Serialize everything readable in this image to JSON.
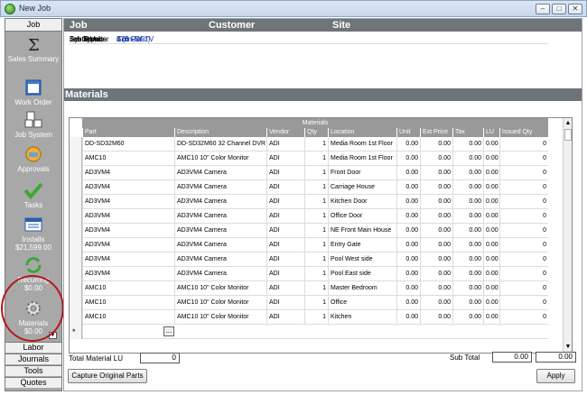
{
  "window": {
    "title": "New Job"
  },
  "sidebar": {
    "header": "Job",
    "items": [
      {
        "label": "Sales Summary",
        "icon": "sigma-icon"
      },
      {
        "label": "Work Order",
        "icon": "work-order-icon"
      },
      {
        "label": "Job System",
        "icon": "job-system-icon"
      },
      {
        "label": "Approvals",
        "icon": "approvals-icon"
      },
      {
        "label": "Tasks",
        "icon": "checkmark-icon"
      },
      {
        "label": "Installs",
        "sub": "$21,599.00",
        "icon": "installs-icon"
      },
      {
        "label": "Recurring",
        "sub": "$0.00",
        "icon": "recurring-icon"
      },
      {
        "label": "Materials",
        "sub": "$0.00",
        "icon": "gear-icon"
      }
    ],
    "bottom": [
      "Labor",
      "Journals",
      "Tools",
      "Quotes"
    ]
  },
  "header": {
    "job": "Job",
    "customer": "Customer",
    "site": "Site"
  },
  "info": {
    "job_number_label": "Job Number",
    "job_number": "176",
    "job_type_label": "Job Type",
    "job_type": "Com-CCTV",
    "job_status_label": "Job Status",
    "job_status": "Sch FW",
    "system_label": "System",
    "system": "",
    "labor_units_label": "Labor Units",
    "labor_units": "8 (0 Used)"
  },
  "materials": {
    "section_title": "Materials",
    "band_title": "Materials",
    "columns": [
      "Part",
      "Description",
      "Vendor",
      "Qty",
      "Location",
      "Unit",
      "Ext Price",
      "Tax",
      "LU",
      "Issued Qty"
    ],
    "rows": [
      [
        "DD-SD32M60",
        "DD-SD32M60 32 Channel DVR",
        "ADI",
        "1",
        "Media Room 1st Floor",
        "0.00",
        "0.00",
        "0.00",
        "0.00",
        "0"
      ],
      [
        "AMC10",
        "AMC10 10\" Color Monitor",
        "ADI",
        "1",
        "Media Room 1st Floor",
        "0.00",
        "0.00",
        "0.00",
        "0.00",
        "0"
      ],
      [
        "AD3VM4",
        "AD3VM4 Camera",
        "ADI",
        "1",
        "Front Door",
        "0.00",
        "0.00",
        "0.00",
        "0.00",
        "0"
      ],
      [
        "AD3VM4",
        "AD3VM4 Camera",
        "ADI",
        "1",
        "Carriage House",
        "0.00",
        "0.00",
        "0.00",
        "0.00",
        "0"
      ],
      [
        "AD3VM4",
        "AD3VM4 Camera",
        "ADI",
        "1",
        "Kitchen Door",
        "0.00",
        "0.00",
        "0.00",
        "0.00",
        "0"
      ],
      [
        "AD3VM4",
        "AD3VM4 Camera",
        "ADI",
        "1",
        "Office Door",
        "0.00",
        "0.00",
        "0.00",
        "0.00",
        "0"
      ],
      [
        "AD3VM4",
        "AD3VM4 Camera",
        "ADI",
        "1",
        "NE Front Main House",
        "0.00",
        "0.00",
        "0.00",
        "0.00",
        "0"
      ],
      [
        "AD3VM4",
        "AD3VM4 Camera",
        "ADI",
        "1",
        "Entry Gate",
        "0.00",
        "0.00",
        "0.00",
        "0.00",
        "0"
      ],
      [
        "AD3VM4",
        "AD3VM4 Camera",
        "ADI",
        "1",
        "Pool West side",
        "0.00",
        "0.00",
        "0.00",
        "0.00",
        "0"
      ],
      [
        "AD3VM4",
        "AD3VM4 Camera",
        "ADI",
        "1",
        "Pool East side",
        "0.00",
        "0.00",
        "0.00",
        "0.00",
        "0"
      ],
      [
        "AMC10",
        "AMC10 10\" Color Monitor",
        "ADI",
        "1",
        "Master Bedroom",
        "0.00",
        "0.00",
        "0.00",
        "0.00",
        "0"
      ],
      [
        "AMC10",
        "AMC10 10\" Color Monitor",
        "ADI",
        "1",
        "Office",
        "0.00",
        "0.00",
        "0.00",
        "0.00",
        "0"
      ],
      [
        "AMC10",
        "AMC10 10\" Color Monitor",
        "ADI",
        "1",
        "Kitchen",
        "0.00",
        "0.00",
        "0.00",
        "0.00",
        "0"
      ]
    ],
    "new_row_marker": "*",
    "ellipsis": "..."
  },
  "footer": {
    "total_lu_label": "Total Material LU",
    "total_lu": "0",
    "subtotal_label": "Sub Total",
    "subtotal_1": "0.00",
    "subtotal_2": "0.00",
    "capture_button": "Capture Original Parts",
    "apply_button": "Apply"
  }
}
